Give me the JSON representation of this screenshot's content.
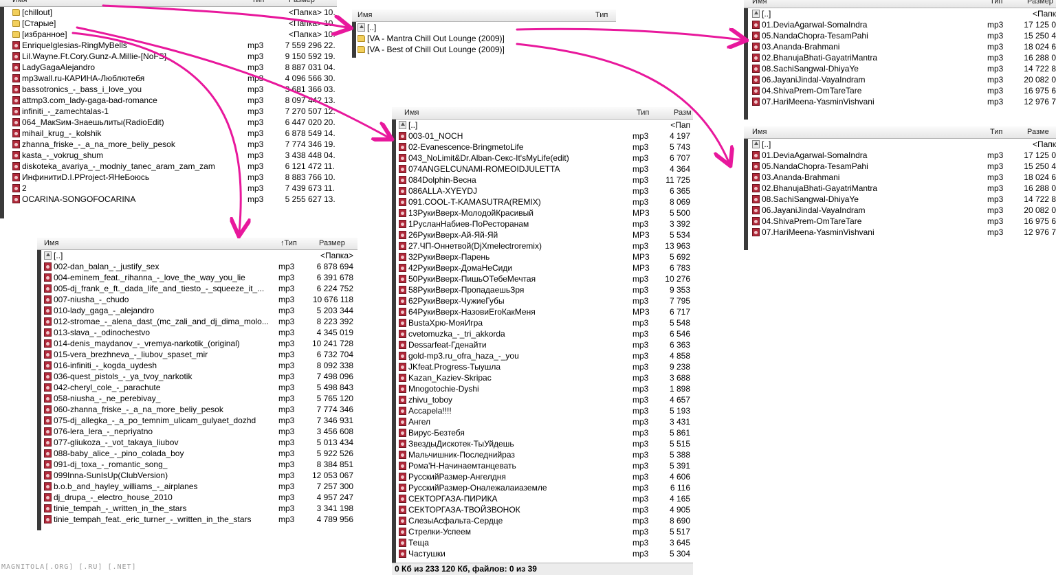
{
  "panel_root": {
    "header": {
      "name": "Имя",
      "type": "Тип",
      "size": "Размер"
    },
    "rows": [
      {
        "icon": "folder-icon",
        "name": "[chillout]",
        "type": "",
        "size": "<Папка>",
        "date": "10."
      },
      {
        "icon": "folder-icon",
        "name": "[Старые]",
        "type": "",
        "size": "<Папка>",
        "date": "10."
      },
      {
        "icon": "folder-icon",
        "name": "[избранное]",
        "type": "",
        "size": "<Папка>",
        "date": "10."
      },
      {
        "icon": "mp3-icon",
        "name": "EnriqueIglesias-RingMyBells",
        "type": "mp3",
        "size": "7 559 296",
        "date": "22."
      },
      {
        "icon": "mp3-icon",
        "name": "Lil.Wayne.Ft.Cory.Gunz-A.Millie-[NoFS]",
        "type": "mp3",
        "size": "9 150 592",
        "date": "19."
      },
      {
        "icon": "mp3-icon",
        "name": "LadyGagaAlejandro",
        "type": "mp3",
        "size": "8 887 031",
        "date": "04."
      },
      {
        "icon": "mp3-icon",
        "name": "mp3wall.ru-КАРИНА-Люблютебя",
        "type": "mp3",
        "size": "4 096 566",
        "date": "30."
      },
      {
        "icon": "mp3-icon",
        "name": "bassotronics_-_bass_i_love_you",
        "type": "mp3",
        "size": "3 681 366",
        "date": "03."
      },
      {
        "icon": "mp3-icon",
        "name": "attmp3.com_lady-gaga-bad-romance",
        "type": "mp3",
        "size": "8 097 442",
        "date": "13."
      },
      {
        "icon": "mp3-icon",
        "name": "infiniti_-_zamechtalas-1",
        "type": "mp3",
        "size": "7 270 507",
        "date": "12."
      },
      {
        "icon": "mp3-icon",
        "name": "064_МакSим-Знаешьлиты(RadioEdit)",
        "type": "mp3",
        "size": "6 447 020",
        "date": "20."
      },
      {
        "icon": "mp3-icon",
        "name": "mihail_krug_-_kolshik",
        "type": "mp3",
        "size": "6 878 549",
        "date": "14."
      },
      {
        "icon": "mp3-icon",
        "name": "zhanna_friske_-_a_na_more_beliy_pesok",
        "type": "mp3",
        "size": "7 774 346",
        "date": "19."
      },
      {
        "icon": "mp3-icon",
        "name": "kasta_-_vokrug_shum",
        "type": "mp3",
        "size": "3 438 448",
        "date": "04."
      },
      {
        "icon": "mp3-icon",
        "name": "diskoteka_avariya_-_modniy_tanec_aram_zam_zam",
        "type": "mp3",
        "size": "6 121 472",
        "date": "11."
      },
      {
        "icon": "mp3-icon",
        "name": "ИнфинитиD.I.PProject-ЯНеБоюсь",
        "type": "mp3",
        "size": "8 883 766",
        "date": "10."
      },
      {
        "icon": "mp3-icon",
        "name": "2",
        "type": "mp3",
        "size": "7 439 673",
        "date": "11."
      },
      {
        "icon": "mp3-icon",
        "name": "OCARINA-SONGOFOCARINA",
        "type": "mp3",
        "size": "5 255 627",
        "date": "13."
      }
    ]
  },
  "panel_chillout": {
    "header": {
      "name": "Имя",
      "type": "Тип"
    },
    "rows": [
      {
        "icon": "up-icon",
        "name": "[..]"
      },
      {
        "icon": "folder-icon",
        "name": "[VA - Mantra Chill Out Lounge (2009)]"
      },
      {
        "icon": "folder-icon",
        "name": "[VA - Best of Chill Out Lounge (2009)]"
      }
    ]
  },
  "panel_mantra": {
    "header": {
      "name": "Имя",
      "type": "Тип",
      "size": "Размер"
    },
    "rows": [
      {
        "icon": "up-icon",
        "name": "[..]",
        "type": "",
        "size": "<Папк"
      },
      {
        "icon": "mp3-icon",
        "name": "01.DeviaAgarwal-SomaIndra",
        "type": "mp3",
        "size": "17 125 0"
      },
      {
        "icon": "mp3-icon",
        "name": "05.NandaChopra-TesamPahi",
        "type": "mp3",
        "size": "15 250 4"
      },
      {
        "icon": "mp3-icon",
        "name": "03.Ananda-Brahmani",
        "type": "mp3",
        "size": "18 024 6"
      },
      {
        "icon": "mp3-icon",
        "name": "02.BhanujaBhati-GayatriMantra",
        "type": "mp3",
        "size": "16 288 0"
      },
      {
        "icon": "mp3-icon",
        "name": "08.SachiSangwal-DhiyaYe",
        "type": "mp3",
        "size": "14 722 8"
      },
      {
        "icon": "mp3-icon",
        "name": "06.JayaniJindal-VayaIndram",
        "type": "mp3",
        "size": "20 082 0"
      },
      {
        "icon": "mp3-icon",
        "name": "04.ShivaPrem-OmTareTare",
        "type": "mp3",
        "size": "16 975 6"
      },
      {
        "icon": "mp3-icon",
        "name": "07.HariMeena-YasminVishvani",
        "type": "mp3",
        "size": "12 976 7"
      }
    ]
  },
  "panel_bestof": {
    "header": {
      "name": "Имя",
      "type": "Тип",
      "size": "Разме"
    },
    "rows": [
      {
        "icon": "up-icon",
        "name": "[..]",
        "type": "",
        "size": "<Папк"
      },
      {
        "icon": "mp3-icon",
        "name": "01.DeviaAgarwal-SomaIndra",
        "type": "mp3",
        "size": "17 125 0"
      },
      {
        "icon": "mp3-icon",
        "name": "05.NandaChopra-TesamPahi",
        "type": "mp3",
        "size": "15 250 4"
      },
      {
        "icon": "mp3-icon",
        "name": "03.Ananda-Brahmani",
        "type": "mp3",
        "size": "18 024 6"
      },
      {
        "icon": "mp3-icon",
        "name": "02.BhanujaBhati-GayatriMantra",
        "type": "mp3",
        "size": "16 288 0"
      },
      {
        "icon": "mp3-icon",
        "name": "08.SachiSangwal-DhiyaYe",
        "type": "mp3",
        "size": "14 722 8"
      },
      {
        "icon": "mp3-icon",
        "name": "06.JayaniJindal-VayaIndram",
        "type": "mp3",
        "size": "20 082 0"
      },
      {
        "icon": "mp3-icon",
        "name": "04.ShivaPrem-OmTareTare",
        "type": "mp3",
        "size": "16 975 6"
      },
      {
        "icon": "mp3-icon",
        "name": "07.HariMeena-YasminVishvani",
        "type": "mp3",
        "size": "12 976 7"
      }
    ]
  },
  "panel_izbrannoe": {
    "header": {
      "name": "Имя",
      "type": "↑Тип",
      "size": "Размер"
    },
    "rows": [
      {
        "icon": "up-icon",
        "name": "[..]",
        "type": "",
        "size": "<Папка>"
      },
      {
        "icon": "mp3-icon",
        "name": "002-dan_balan_-_justify_sex",
        "type": "mp3",
        "size": "6 878 694"
      },
      {
        "icon": "mp3-icon",
        "name": "004-eminem_feat._rihanna_-_love_the_way_you_lie",
        "type": "mp3",
        "size": "6 391 678"
      },
      {
        "icon": "mp3-icon",
        "name": "005-dj_frank_e_ft._dada_life_and_tiesto_-_squeeze_it_...",
        "type": "mp3",
        "size": "6 224 752"
      },
      {
        "icon": "mp3-icon",
        "name": "007-niusha_-_chudo",
        "type": "mp3",
        "size": "10 676 118"
      },
      {
        "icon": "mp3-icon",
        "name": "010-lady_gaga_-_alejandro",
        "type": "mp3",
        "size": "5 203 344"
      },
      {
        "icon": "mp3-icon",
        "name": "012-stromae_-_alena_dast_(mc_zali_and_dj_dima_molo...",
        "type": "mp3",
        "size": "8 223 392"
      },
      {
        "icon": "mp3-icon",
        "name": "013-slava_-_odinochestvo",
        "type": "mp3",
        "size": "4 345 019"
      },
      {
        "icon": "mp3-icon",
        "name": "014-denis_maydanov_-_vremya-narkotik_(original)",
        "type": "mp3",
        "size": "10 241 728"
      },
      {
        "icon": "mp3-icon",
        "name": "015-vera_brezhneva_-_liubov_spaset_mir",
        "type": "mp3",
        "size": "6 732 704"
      },
      {
        "icon": "mp3-icon",
        "name": "016-infiniti_-_kogda_uydesh",
        "type": "mp3",
        "size": "8 092 338"
      },
      {
        "icon": "mp3-icon",
        "name": "036-quest_pistols_-_ya_tvoy_narkotik",
        "type": "mp3",
        "size": "7 498 096"
      },
      {
        "icon": "mp3-icon",
        "name": "042-cheryl_cole_-_parachute",
        "type": "mp3",
        "size": "5 498 843"
      },
      {
        "icon": "mp3-icon",
        "name": "058-niusha_-_ne_perebivay_",
        "type": "mp3",
        "size": "5 765 120"
      },
      {
        "icon": "mp3-icon",
        "name": "060-zhanna_friske_-_a_na_more_beliy_pesok",
        "type": "mp3",
        "size": "7 774 346"
      },
      {
        "icon": "mp3-icon",
        "name": "075-dj_allegka_-_a_po_temnim_ulicam_gulyaet_dozhd",
        "type": "mp3",
        "size": "7 346 931"
      },
      {
        "icon": "mp3-icon",
        "name": "076-lera_lera_-_nepriyatno",
        "type": "mp3",
        "size": "3 456 608"
      },
      {
        "icon": "mp3-icon",
        "name": "077-gliukoza_-_vot_takaya_liubov",
        "type": "mp3",
        "size": "5 013 434"
      },
      {
        "icon": "mp3-icon",
        "name": "088-baby_alice_-_pino_colada_boy",
        "type": "mp3",
        "size": "5 922 526"
      },
      {
        "icon": "mp3-icon",
        "name": "091-dj_toxa_-_romantic_song_",
        "type": "mp3",
        "size": "8 384 851"
      },
      {
        "icon": "mp3-icon",
        "name": "099Inna-SunIsUp(ClubVersion)",
        "type": "mp3",
        "size": "12 053 067"
      },
      {
        "icon": "mp3-icon",
        "name": "b.o.b_and_hayley_williams_-_airplanes",
        "type": "mp3",
        "size": "7 257 300"
      },
      {
        "icon": "mp3-icon",
        "name": "dj_drupa_-_electro_house_2010",
        "type": "mp3",
        "size": "4 957 247"
      },
      {
        "icon": "mp3-icon",
        "name": "tinie_tempah_-_written_in_the_stars",
        "type": "mp3",
        "size": "3 341 198"
      },
      {
        "icon": "mp3-icon",
        "name": "tinie_tempah_feat._eric_turner_-_written_in_the_stars",
        "type": "mp3",
        "size": "4 789 956"
      }
    ]
  },
  "panel_starye": {
    "header": {
      "name": "Имя",
      "type": "Тип",
      "size": "Разм"
    },
    "rows": [
      {
        "icon": "up-icon",
        "name": "[..]",
        "type": "",
        "size": "<Пап"
      },
      {
        "icon": "mp3-icon",
        "name": "003-01_NOCH",
        "type": "mp3",
        "size": "4 197"
      },
      {
        "icon": "mp3-icon",
        "name": "02-Evanescence-BringmetoLife",
        "type": "mp3",
        "size": "5 743"
      },
      {
        "icon": "mp3-icon",
        "name": "043_NoLimit&Dr.Alban-Секс-It'sMyLife(edit)",
        "type": "mp3",
        "size": "6 707"
      },
      {
        "icon": "mp3-icon",
        "name": "074ANGELCUNAMI-ROMEOIDJULETTA",
        "type": "mp3",
        "size": "4 364"
      },
      {
        "icon": "mp3-icon",
        "name": "084Dolphin-Весна",
        "type": "mp3",
        "size": "11 725"
      },
      {
        "icon": "mp3-icon",
        "name": "086ALLA-XYEYDJ",
        "type": "mp3",
        "size": "6 365"
      },
      {
        "icon": "mp3-icon",
        "name": "091.COOL-T-KAMASUTRA(REMIX)",
        "type": "mp3",
        "size": "8 069"
      },
      {
        "icon": "mp3-icon",
        "name": "13РукиВверх-МолодойКрасивый",
        "type": "MP3",
        "size": "5 500"
      },
      {
        "icon": "mp3-icon",
        "name": "1РусланНабиев-ПоРесторанам",
        "type": "mp3",
        "size": "3 392"
      },
      {
        "icon": "mp3-icon",
        "name": "26РукиВверх-Ай-Яй-Яй",
        "type": "MP3",
        "size": "5 534"
      },
      {
        "icon": "mp3-icon",
        "name": "27.ЧП-Оннетвой(DjXmelectroremix)",
        "type": "mp3",
        "size": "13 963"
      },
      {
        "icon": "mp3-icon",
        "name": "32РукиВверх-Парень",
        "type": "MP3",
        "size": "5 692"
      },
      {
        "icon": "mp3-icon",
        "name": "42РукиВверх-ДомаНеСиди",
        "type": "MP3",
        "size": "6 783"
      },
      {
        "icon": "mp3-icon",
        "name": "50РукиВверх-ПишьОТебеМечтая",
        "type": "mp3",
        "size": "10 276"
      },
      {
        "icon": "mp3-icon",
        "name": "58РукиВверх-ПропадаешьЗря",
        "type": "mp3",
        "size": "9 353"
      },
      {
        "icon": "mp3-icon",
        "name": "62РукиВверх-ЧужиеГубы",
        "type": "mp3",
        "size": "7 795"
      },
      {
        "icon": "mp3-icon",
        "name": "64РукиВверх-НазовиЕгоКакМеня",
        "type": "MP3",
        "size": "6 717"
      },
      {
        "icon": "mp3-icon",
        "name": "BustaХрю-МояИгра",
        "type": "mp3",
        "size": "5 548"
      },
      {
        "icon": "mp3-icon",
        "name": "cvetomuzka_-_tri_akkorda",
        "type": "mp3",
        "size": "6 546"
      },
      {
        "icon": "mp3-icon",
        "name": "Dessarfeat-Гденайти",
        "type": "mp3",
        "size": "6 363"
      },
      {
        "icon": "mp3-icon",
        "name": "gold-mp3.ru_ofra_haza_-_you",
        "type": "mp3",
        "size": "4 858"
      },
      {
        "icon": "mp3-icon",
        "name": "JKfeat.Progress-Тыушла",
        "type": "mp3",
        "size": "9 238"
      },
      {
        "icon": "mp3-icon",
        "name": "Kazan_Kaziev-Skripac",
        "type": "mp3",
        "size": "3 688"
      },
      {
        "icon": "mp3-icon",
        "name": "Mnogotochie-Dyshi",
        "type": "mp3",
        "size": "1 898"
      },
      {
        "icon": "mp3-icon",
        "name": "zhivu_toboy",
        "type": "mp3",
        "size": "4 657"
      },
      {
        "icon": "mp3-icon",
        "name": "Accapela!!!!",
        "type": "mp3",
        "size": "5 193"
      },
      {
        "icon": "mp3-icon",
        "name": "Ангел",
        "type": "mp3",
        "size": "3 431"
      },
      {
        "icon": "mp3-icon",
        "name": "Вирус-Безтебя",
        "type": "mp3",
        "size": "5 861"
      },
      {
        "icon": "mp3-icon",
        "name": "ЗвездыДискотек-ТыУйдешь",
        "type": "mp3",
        "size": "5 515"
      },
      {
        "icon": "mp3-icon",
        "name": "Мальчишник-Последнийраз",
        "type": "mp3",
        "size": "5 388"
      },
      {
        "icon": "mp3-icon",
        "name": "Рома'Н-Начинаемтанцевать",
        "type": "mp3",
        "size": "5 391"
      },
      {
        "icon": "mp3-icon",
        "name": "РусскийРазмер-Ангелдня",
        "type": "mp3",
        "size": "4 606"
      },
      {
        "icon": "mp3-icon",
        "name": "РусскийРазмер-Оналежалаиаземле",
        "type": "mp3",
        "size": "6 116"
      },
      {
        "icon": "mp3-icon",
        "name": "СЕКТОРГАЗА-ПИРИКА",
        "type": "mp3",
        "size": "4 165"
      },
      {
        "icon": "mp3-icon",
        "name": "СЕКТОРГАЗА-ТВОЙЗВОНОК",
        "type": "mp3",
        "size": "4 905"
      },
      {
        "icon": "mp3-icon",
        "name": "СлезыАсфальта-Сердце",
        "type": "mp3",
        "size": "8 690"
      },
      {
        "icon": "mp3-icon",
        "name": "Стрелки-Успеем",
        "type": "mp3",
        "size": "5 517"
      },
      {
        "icon": "mp3-icon",
        "name": "Теща",
        "type": "mp3",
        "size": "3 645"
      },
      {
        "icon": "mp3-icon",
        "name": "Частушки",
        "type": "mp3",
        "size": "5 304"
      }
    ],
    "status": "0 Кб из 233 120 Кб, файлов: 0 из 39"
  },
  "watermark": "MAGNITOLA[.ORG] [.RU] [.NET]",
  "colors": {
    "arrow": "#e8189c",
    "mp3_icon": "#b0293a",
    "folder_icon": "#f2cf5c",
    "scrollbar": "#3a3a3a"
  }
}
